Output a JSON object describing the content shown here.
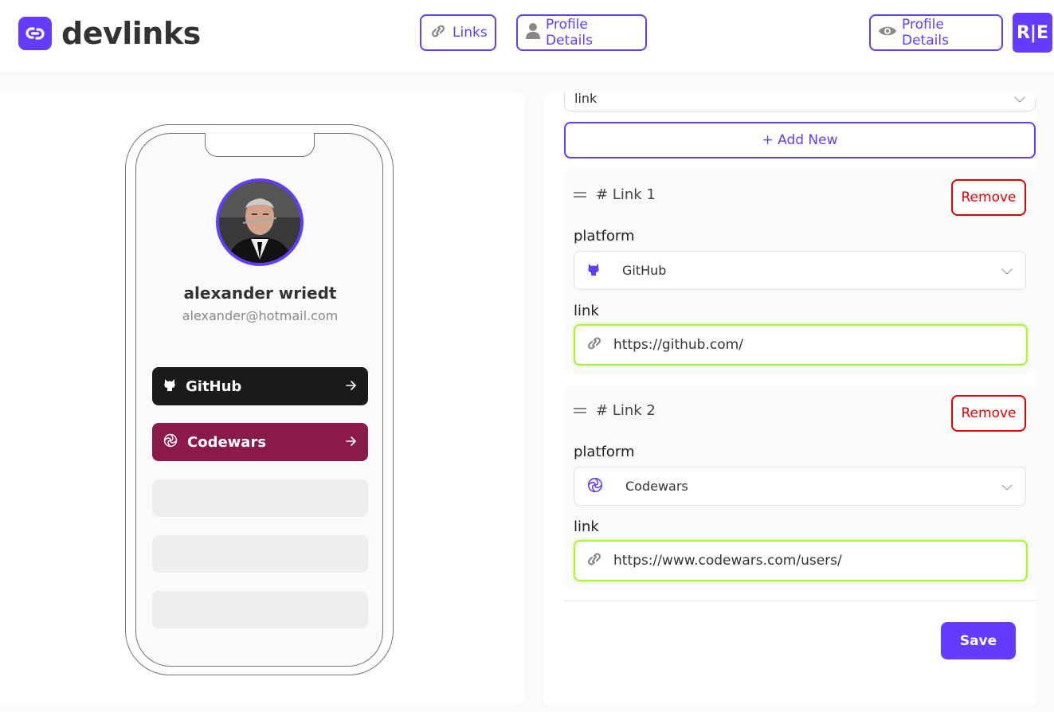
{
  "header": {
    "brand": "devlinks",
    "nav_links": "Links",
    "nav_profile": "Profile Details",
    "preview_button": "Profile Details",
    "user_initials": "R|E"
  },
  "preview": {
    "name": "alexander wriedt",
    "email": "alexander@hotmail.com",
    "links": [
      {
        "platform": "GitHub",
        "color": "#1a1a1a",
        "icon": "github-icon"
      },
      {
        "platform": "Codewars",
        "color": "#8a1a4b",
        "icon": "codewars-icon"
      }
    ],
    "empty_slots": 3
  },
  "editor": {
    "partial_select_value": "link",
    "add_new": "+ Add New",
    "links": [
      {
        "heading": "# Link 1",
        "remove": "Remove",
        "platform_label": "platform",
        "platform": "GitHub",
        "platform_icon": "github-icon",
        "link_label": "link",
        "url": "https://github.com/"
      },
      {
        "heading": "# Link 2",
        "remove": "Remove",
        "platform_label": "platform",
        "platform": "Codewars",
        "platform_icon": "codewars-icon",
        "link_label": "link",
        "url": "https://www.codewars.com/users/"
      }
    ],
    "save": "Save"
  },
  "colors": {
    "accent": "#633cff",
    "danger": "#e60000",
    "focus": "#a6f536"
  }
}
